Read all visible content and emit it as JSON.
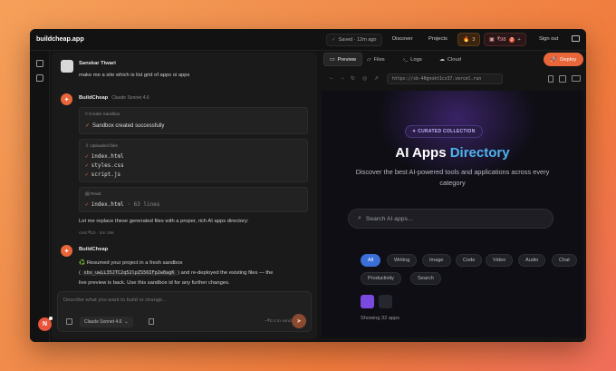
{
  "app": {
    "brand": "buildcheap.app"
  },
  "topbar": {
    "saved": "Saved · 12m ago",
    "discover": "Discover",
    "projects": "Projects",
    "fire_count": "3",
    "money": "₹98",
    "money_badge": "2",
    "signout": "Sign out"
  },
  "chat": {
    "user": {
      "name": "Sanskar Tiwari",
      "text": "make me a site which is list grid of apps oi apps"
    },
    "bot1": {
      "name": "BuildCheap",
      "model": "Claude Sonnet 4.6",
      "tool1": {
        "header": "Create Sandbox",
        "line": "Sandbox created successfully"
      },
      "tool2": {
        "header": "Uploaded files",
        "files": [
          "index.html",
          "styles.css",
          "script.js"
        ]
      },
      "tool3": {
        "header": "Read",
        "file": "index.html",
        "lines": "· 63 lines"
      },
      "text": "Let me replace these generated files with a proper, rich AI apps directory:",
      "cost": "cost ₹10 · 2m 19s"
    },
    "bot2": {
      "name": "BuildCheap",
      "line1": "♻️ Resumed your project in a fresh sandbox",
      "sandbox_id": "sbx_uwLL35JTC2q52lpZS56IFp2w8agK",
      "line2": "and re-deployed the existing files — the",
      "line3": "live preview is back. Use this sandbox id for any further changes."
    },
    "composer": {
      "placeholder": "Describe what you want to build or change...",
      "model": "Claude Sonnet 4.6",
      "hint": "~₹0.2 to send"
    },
    "avatar_initial": "N"
  },
  "preview": {
    "tabs": [
      "Preview",
      "Files",
      "Logs",
      "Cloud"
    ],
    "deploy": "Deploy",
    "url": "https://sb-40gnokt1cz37.vercel.run",
    "site": {
      "badge": "✦ CURATED COLLECTION",
      "title_a": "AI Apps ",
      "title_b": "Directory",
      "subtitle": "Discover the best AI-powered tools and applications across every category",
      "search_placeholder": "Search AI apps...",
      "chips": [
        "All",
        "Writing",
        "Image",
        "Code",
        "Video",
        "Audio",
        "Chat",
        "Productivity",
        "Search"
      ],
      "showing": "Showing 32 apps"
    }
  },
  "colors": {
    "accent": "#e8663a",
    "brand_blue": "#4fb4f0",
    "chip_active": "#3a6fd8",
    "view_active": "#7a4ae0"
  }
}
